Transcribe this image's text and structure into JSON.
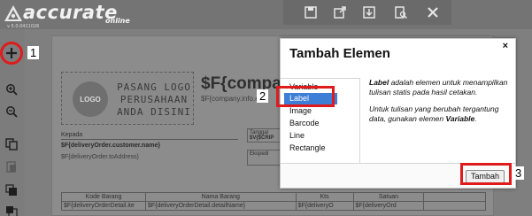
{
  "app": {
    "brand_name": "accurate",
    "brand_sub": "online",
    "version": "v 5.0.0411026"
  },
  "toolbar": {
    "icons": [
      "save-icon",
      "export-icon",
      "download-icon",
      "preview-icon",
      "close-icon"
    ]
  },
  "leftbar": {
    "icons": [
      "add-icon",
      "zoom-in-icon",
      "zoom-out-icon",
      "copy-icon",
      "paste-icon",
      "bring-front-icon",
      "send-back-icon"
    ]
  },
  "callouts": {
    "one": "1",
    "two": "2",
    "three": "3"
  },
  "page": {
    "logo_badge": "LOGO",
    "logo_text": "PASANG LOGO PERUSAHAAN ANDA DISINI",
    "company_title": "$F{compar",
    "company_email": "$F{company.info.e",
    "kepada_label": "Kepada",
    "customer_name": "$F{deliveryOrder.customer.name}",
    "to_address": "$F{deliveryOrder.toAddress}",
    "tanggal_label": "Tanggal",
    "tanggal_value": "$V{$CRIP",
    "ekspedisi_label": "Ekspedi",
    "table": {
      "headers": [
        "Kode Barang",
        "Nama Barang",
        "Kts",
        "Satuan"
      ],
      "row": [
        "$F{deliveryOrderDetail.ite",
        "$F{deliveryOrderDetail.detailName}",
        "$F{deliveryO",
        "$F{deliveryOrd"
      ]
    }
  },
  "modal": {
    "title": "Tambah Elemen",
    "close": "×",
    "items": [
      "Variable",
      "Label",
      "Image",
      "Barcode",
      "Line",
      "Rectangle"
    ],
    "selected_index": 1,
    "desc1_bold": "Label",
    "desc1_rest": " adalah elemen untuk menampilkan tulisan statis pada hasil cetakan.",
    "desc2_start": "Untuk tulisan yang berubah tergantung data, gunakan elemen ",
    "desc2_bold": "Variable",
    "desc2_end": ".",
    "button": "Tambah"
  },
  "colors": {
    "accent_red": "#e01b1b",
    "selection_blue": "#3d7fd6"
  }
}
